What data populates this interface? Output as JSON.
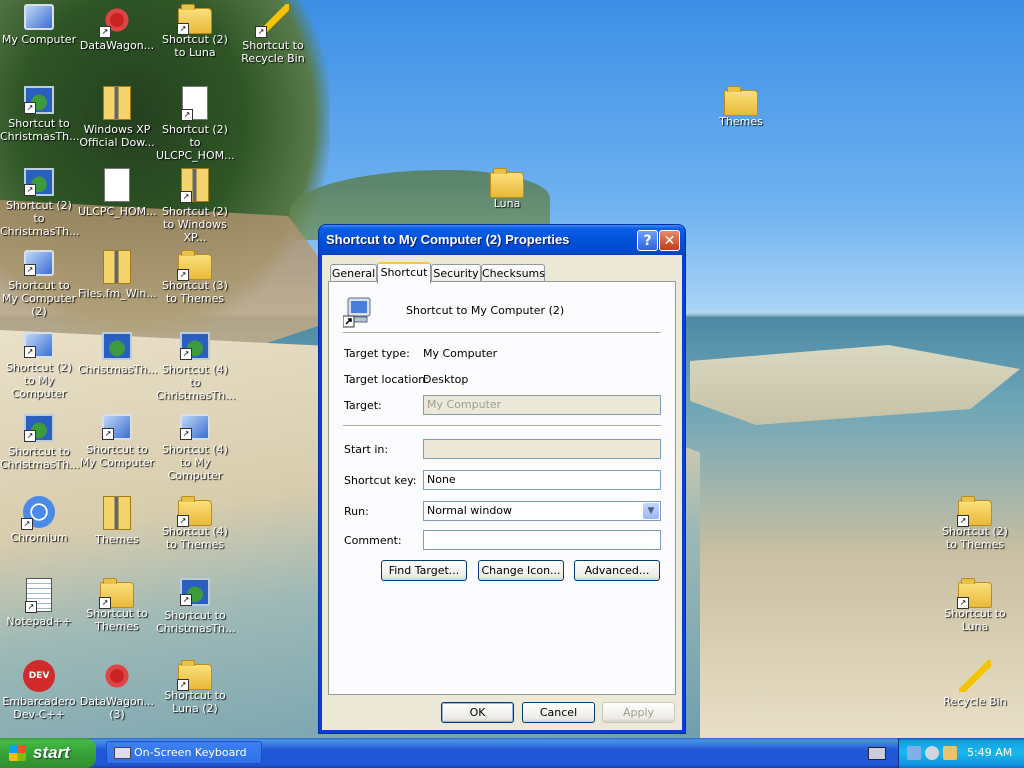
{
  "desktop": {
    "icons": [
      {
        "label": "My Computer",
        "type": "computer",
        "shortcut": false
      },
      {
        "label": "DataWagon...",
        "type": "red",
        "shortcut": true
      },
      {
        "label": "Shortcut (2) to Luna",
        "type": "folder",
        "shortcut": true
      },
      {
        "label": "Shortcut to Recycle Bin",
        "type": "boat",
        "shortcut": true
      },
      {
        "label": "Shortcut to ChristmasTh...",
        "type": "theme",
        "shortcut": true
      },
      {
        "label": "Windows XP Official Dow...",
        "type": "zip",
        "shortcut": false
      },
      {
        "label": "Shortcut (2) to ULCPC_HOM...",
        "type": "doc",
        "shortcut": true
      },
      {
        "label": "Shortcut (2) to ChristmasTh...",
        "type": "theme",
        "shortcut": true
      },
      {
        "label": "ULCPC_HOM...",
        "type": "doc",
        "shortcut": false
      },
      {
        "label": "Shortcut (2) to Windows XP...",
        "type": "zip",
        "shortcut": true
      },
      {
        "label": "Shortcut to My Computer (2)",
        "type": "computer",
        "shortcut": true
      },
      {
        "label": "Files.fm_Win...",
        "type": "zip",
        "shortcut": false
      },
      {
        "label": "Shortcut (3) to Themes",
        "type": "folder",
        "shortcut": true
      },
      {
        "label": "Shortcut (2) to My Computer",
        "type": "computer",
        "shortcut": true
      },
      {
        "label": "ChristmasTh...",
        "type": "theme",
        "shortcut": false
      },
      {
        "label": "Shortcut (4) to ChristmasTh...",
        "type": "theme",
        "shortcut": true
      },
      {
        "label": "Shortcut to ChristmasTh...",
        "type": "theme",
        "shortcut": true
      },
      {
        "label": "Shortcut to My Computer",
        "type": "computer",
        "shortcut": true
      },
      {
        "label": "Shortcut (4) to My Computer",
        "type": "computer",
        "shortcut": true
      },
      {
        "label": "Chromium",
        "type": "chrome",
        "shortcut": true
      },
      {
        "label": "Themes",
        "type": "zip",
        "shortcut": false
      },
      {
        "label": "Shortcut (4) to Themes",
        "type": "folder",
        "shortcut": true
      },
      {
        "label": "Notepad++",
        "type": "notepad",
        "shortcut": true
      },
      {
        "label": "Shortcut to Themes",
        "type": "folder",
        "shortcut": true
      },
      {
        "label": "Shortcut to ChristmasTh...",
        "type": "theme",
        "shortcut": true
      },
      {
        "label": "Embarcadero Dev-C++",
        "type": "dev",
        "shortcut": false
      },
      {
        "label": "DataWagon... (3)",
        "type": "red",
        "shortcut": false
      },
      {
        "label": "Shortcut to Luna (2)",
        "type": "folder",
        "shortcut": true
      },
      {
        "label": "Themes",
        "type": "folder",
        "shortcut": false
      },
      {
        "label": "Luna",
        "type": "folder",
        "shortcut": false
      },
      {
        "label": "Shortcut (2) to Themes",
        "type": "folder",
        "shortcut": true
      },
      {
        "label": "Shortcut to Luna",
        "type": "folder",
        "shortcut": true
      },
      {
        "label": "Recycle Bin",
        "type": "boat",
        "shortcut": false
      }
    ]
  },
  "dialog": {
    "title": "Shortcut to My Computer (2) Properties",
    "help_glyph": "?",
    "close_glyph": "✕",
    "tabs": [
      "General",
      "Shortcut",
      "Security",
      "Checksums"
    ],
    "active_tab": "Shortcut",
    "shortcut_name": "Shortcut to My Computer (2)",
    "target_type_label": "Target type:",
    "target_type_value": "My Computer",
    "target_location_label": "Target location:",
    "target_location_value": "Desktop",
    "target_label": "Target:",
    "target_value": "My Computer",
    "start_in_label": "Start in:",
    "start_in_value": "",
    "shortcut_key_label": "Shortcut key:",
    "shortcut_key_value": "None",
    "run_label": "Run:",
    "run_value": "Normal window",
    "comment_label": "Comment:",
    "comment_value": "",
    "find_target_label": "Find Target...",
    "change_icon_label": "Change Icon...",
    "advanced_label": "Advanced...",
    "ok_label": "OK",
    "cancel_label": "Cancel",
    "apply_label": "Apply"
  },
  "taskbar": {
    "start_label": "start",
    "task_label": "On-Screen Keyboard",
    "clock": "5:49 AM"
  },
  "colors": {
    "titlebar": "#0052d9",
    "client": "#ece9d8",
    "start": "#37a237",
    "taskbar": "#2157d7"
  }
}
